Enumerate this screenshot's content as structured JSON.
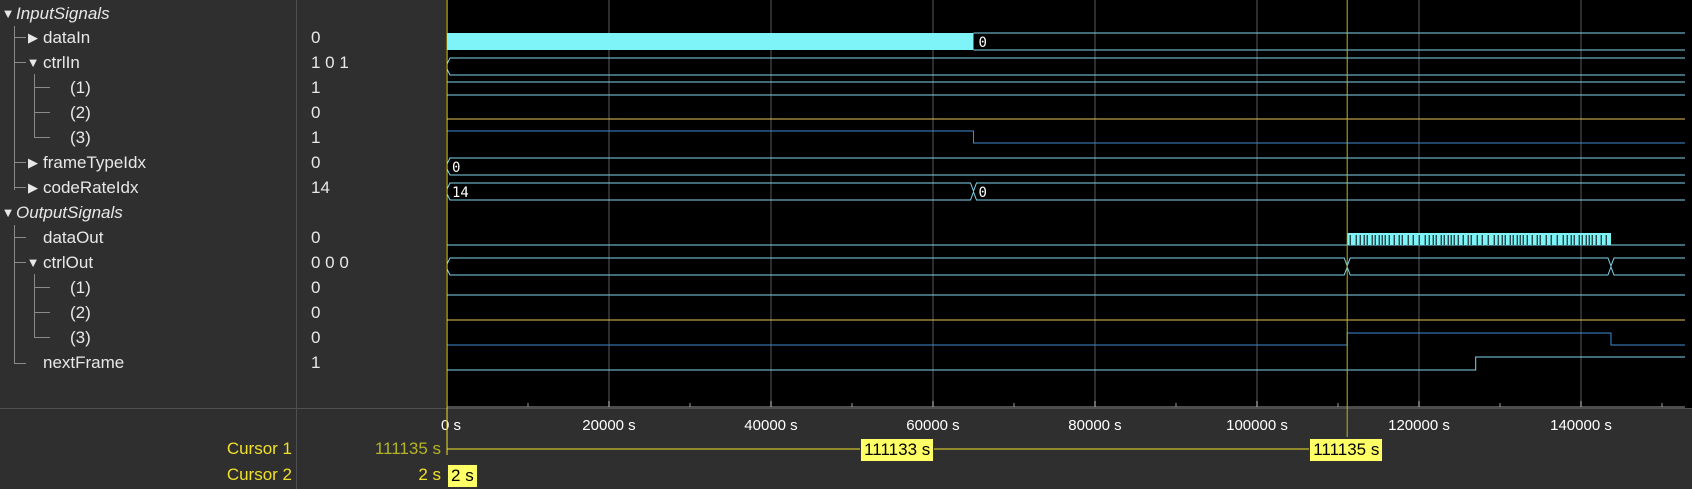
{
  "groups": {
    "input": "InputSignals",
    "output": "OutputSignals"
  },
  "signals": [
    {
      "key": "dataIn",
      "name": "dataIn",
      "value": "0",
      "expand": "▶"
    },
    {
      "key": "ctrlIn",
      "name": "ctrlIn",
      "value": "1 0 1",
      "expand": "▼"
    },
    {
      "key": "ctrlIn1",
      "name": "(1)",
      "value": "1"
    },
    {
      "key": "ctrlIn2",
      "name": "(2)",
      "value": "0"
    },
    {
      "key": "ctrlIn3",
      "name": "(3)",
      "value": "1"
    },
    {
      "key": "frameTypeIdx",
      "name": "frameTypeIdx",
      "value": "0",
      "expand": "▶"
    },
    {
      "key": "codeRateIdx",
      "name": "codeRateIdx",
      "value": "14",
      "expand": "▶"
    },
    {
      "key": "dataOut",
      "name": "dataOut",
      "value": "0"
    },
    {
      "key": "ctrlOut",
      "name": "ctrlOut",
      "value": "0 0 0",
      "expand": "▼"
    },
    {
      "key": "ctrlOut1",
      "name": "(1)",
      "value": "0"
    },
    {
      "key": "ctrlOut2",
      "name": "(2)",
      "value": "0"
    },
    {
      "key": "ctrlOut3",
      "name": "(3)",
      "value": "0"
    },
    {
      "key": "nextFrame",
      "name": "nextFrame",
      "value": "1"
    }
  ],
  "axis": {
    "unit": "s",
    "ticks": [
      0,
      20000,
      40000,
      60000,
      80000,
      100000,
      120000,
      140000
    ],
    "tick_labels": [
      "0 s",
      "20000 s",
      "40000 s",
      "60000 s",
      "80000 s",
      "100000 s",
      "120000 s",
      "140000 s"
    ],
    "time_range": [
      0,
      153700
    ]
  },
  "waves": {
    "dataIn": {
      "busy_until": 65000,
      "after_label": "0"
    },
    "ctrlIn1": {
      "level": 1
    },
    "ctrlIn2": {
      "level": 0
    },
    "ctrlIn3": {
      "high_until": 65000
    },
    "frameTypeIdx": {
      "label": "0"
    },
    "codeRateIdx": {
      "first_label": "14",
      "change_at": 65000,
      "second_label": "0"
    },
    "dataOut": {
      "busy_from": 111135,
      "busy_to": 143700
    },
    "ctrlOut": {
      "changes": [
        111135,
        143700
      ]
    },
    "ctrlOut3": {
      "high_from": 111135,
      "high_to": 143700
    },
    "nextFrame": {
      "rise_at": 127000
    }
  },
  "cursors": [
    {
      "name": "Cursor 1",
      "time_label": "111135 s",
      "time": 111135,
      "box": "111135 s",
      "color": "#b4b424"
    },
    {
      "name": "Cursor 2",
      "time_label": "2 s",
      "time": 2,
      "box": "2 s",
      "color": "#f0e02a"
    }
  ],
  "delta_label": "111133 s",
  "colors": {
    "bus": "#7ff4f8",
    "logic": "#7fd6ee",
    "logic_zero_ctrl2": "#e8c35a",
    "logic_ctrl3": "#3f8bd8",
    "grid": "#5a5a5a",
    "cursor1": "#b4b424",
    "cursor2": "#f0e02a",
    "box_bg": "#ffff66"
  }
}
